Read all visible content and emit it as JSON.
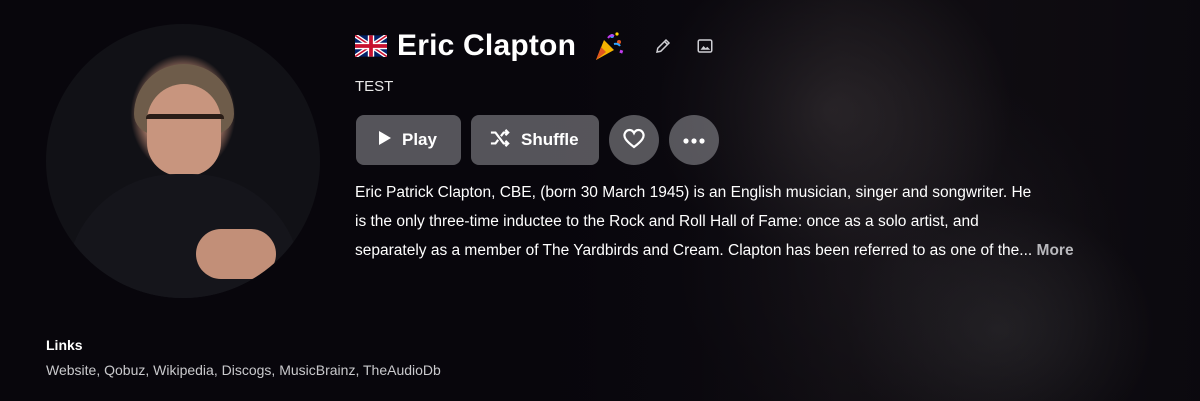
{
  "artist": {
    "name": "Eric Clapton",
    "subtitle": "TEST",
    "flag_icon": "uk-flag-icon",
    "badge_icon": "party-popper-icon"
  },
  "header_icons": {
    "edit": "pencil-icon",
    "image": "image-icon"
  },
  "actions": {
    "play_label": "Play",
    "shuffle_label": "Shuffle",
    "favorite_icon": "heart-icon",
    "more_icon": "more-dots-icon"
  },
  "bio": {
    "line1": "Eric Patrick Clapton, CBE, (born 30 March 1945) is an English musician, singer and songwriter. He",
    "line2": "is the only three-time inductee to the Rock and Roll Hall of Fame: once as a solo artist, and",
    "line3": "separately as a member of The Yardbirds and Cream. Clapton has been referred to as one of the...",
    "more_label": "More"
  },
  "links": {
    "title": "Links",
    "items": [
      "Website",
      "Qobuz",
      "Wikipedia",
      "Discogs",
      "MusicBrainz",
      "TheAudioDb"
    ],
    "separator": ", "
  },
  "colors": {
    "background": "#0a0810",
    "button_bg": "#8a8a90",
    "more_link": "#b9b9bd"
  }
}
